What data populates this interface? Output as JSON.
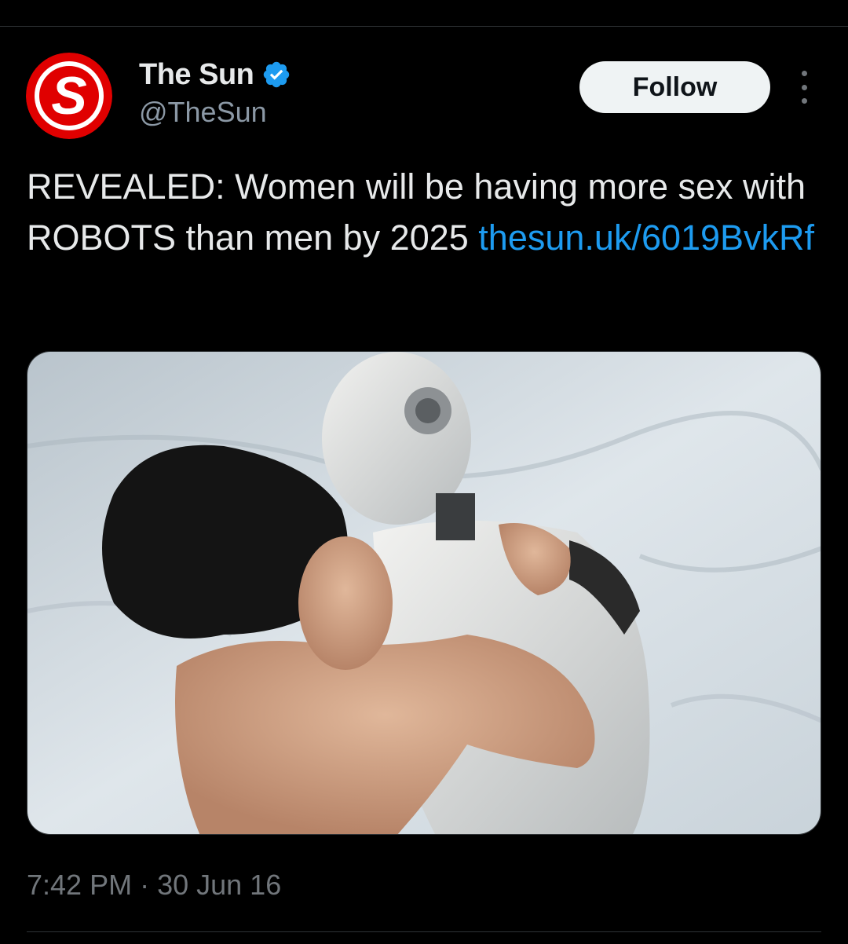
{
  "colors": {
    "background": "#000000",
    "text_primary": "#e7e9ea",
    "text_secondary": "#71767b",
    "link": "#1d9bf0",
    "verified_badge": "#1d9bf0",
    "follow_bg": "#eff3f4",
    "divider": "#2f3336",
    "avatar_red": "#e00000"
  },
  "author": {
    "display_name": "The Sun",
    "handle": "@TheSun",
    "avatar_icon": "the-sun-logo",
    "avatar_letter": "S",
    "verified_icon": "verified-badge-icon"
  },
  "actions": {
    "follow_label": "Follow",
    "more_icon": "more-options-icon"
  },
  "tweet": {
    "text": "REVEALED: Women will be having more sex with ROBOTS than men by 2025 ",
    "link_text": "thesun.uk/6019BvkRf"
  },
  "media": {
    "type": "photo"
  },
  "meta": {
    "time": "7:42 PM",
    "separator": "·",
    "date": "30 Jun 16"
  }
}
